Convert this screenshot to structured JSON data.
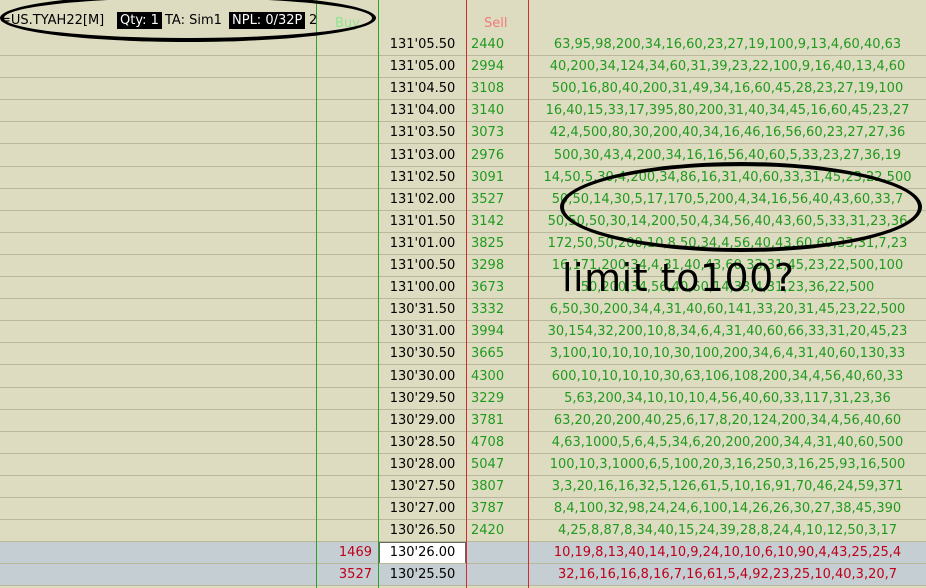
{
  "header": {
    "symbol": "=US.TYAH22[M]",
    "qty": "Qty: 1",
    "ta": "TA: Sim1",
    "npl": "NPL: 0/32P",
    "extra": "2",
    "buy_label": "Buy",
    "sell_label": "Sell"
  },
  "colors": {
    "background": "#dedcc0",
    "green_text": "#1f9a1f",
    "red_text": "#c0001a",
    "bid_row_bg": "#c4ced3",
    "grid_line": "#b9b79c"
  },
  "rows": [
    {
      "price": "131'05.50",
      "buy": "",
      "sell": "2440",
      "depth": "63,95,98,200,34,16,60,23,27,19,100,9,13,4,60,40,63",
      "low": false
    },
    {
      "price": "131'05.00",
      "buy": "",
      "sell": "2994",
      "depth": "40,200,34,124,34,60,31,39,23,22,100,9,16,40,13,4,60",
      "low": false
    },
    {
      "price": "131'04.50",
      "buy": "",
      "sell": "3108",
      "depth": "500,16,80,40,200,31,49,34,16,60,45,28,23,27,19,100",
      "low": false
    },
    {
      "price": "131'04.00",
      "buy": "",
      "sell": "3140",
      "depth": "16,40,15,33,17,395,80,200,31,40,34,45,16,60,45,23,27",
      "low": false
    },
    {
      "price": "131'03.50",
      "buy": "",
      "sell": "3073",
      "depth": "42,4,500,80,30,200,40,34,16,46,16,56,60,23,27,27,36",
      "low": false
    },
    {
      "price": "131'03.00",
      "buy": "",
      "sell": "2976",
      "depth": "500,30,43,4,200,34,16,16,56,40,60,5,33,23,27,36,19",
      "low": false
    },
    {
      "price": "131'02.50",
      "buy": "",
      "sell": "3091",
      "depth": "14,50,5,30,4,200,34,86,16,31,40,60,33,31,45,23,22,500",
      "low": false
    },
    {
      "price": "131'02.00",
      "buy": "",
      "sell": "3527",
      "depth": "50,50,14,30,5,17,170,5,200,4,34,16,56,40,43,60,33,7",
      "low": false
    },
    {
      "price": "131'01.50",
      "buy": "",
      "sell": "3142",
      "depth": "50,50,50,30,14,200,50,4,34,56,40,43,60,5,33,31,23,36",
      "low": false
    },
    {
      "price": "131'01.00",
      "buy": "",
      "sell": "3825",
      "depth": "172,50,50,200,10,8,50,34,4,56,40,43,60,60,33,31,7,23",
      "low": false
    },
    {
      "price": "131'00.50",
      "buy": "",
      "sell": "3298",
      "depth": "16,171,200,34,4,31,40,43,60,33,31,45,23,22,500,100",
      "low": false
    },
    {
      "price": "131'00.00",
      "buy": "",
      "sell": "3673",
      "depth": "50,200,34,56,40,60,14,33,4,31,23,36,22,500",
      "low": false
    },
    {
      "price": "130'31.50",
      "buy": "",
      "sell": "3332",
      "depth": "6,50,30,200,34,4,31,40,60,141,33,20,31,45,23,22,500",
      "low": false
    },
    {
      "price": "130'31.00",
      "buy": "",
      "sell": "3994",
      "depth": "30,154,32,200,10,8,34,6,4,31,40,60,66,33,31,20,45,23",
      "low": false
    },
    {
      "price": "130'30.50",
      "buy": "",
      "sell": "3665",
      "depth": "3,100,10,10,10,10,30,100,200,34,6,4,31,40,60,130,33",
      "low": false
    },
    {
      "price": "130'30.00",
      "buy": "",
      "sell": "4300",
      "depth": "600,10,10,10,10,30,63,106,108,200,34,4,56,40,60,33",
      "low": false
    },
    {
      "price": "130'29.50",
      "buy": "",
      "sell": "3229",
      "depth": "5,63,200,34,10,10,10,4,56,40,60,33,117,31,23,36",
      "low": false
    },
    {
      "price": "130'29.00",
      "buy": "",
      "sell": "3781",
      "depth": "63,20,20,200,40,25,6,17,8,20,124,200,34,4,56,40,60",
      "low": false
    },
    {
      "price": "130'28.50",
      "buy": "",
      "sell": "4708",
      "depth": "4,63,1000,5,6,4,5,34,6,20,200,200,34,4,31,40,60,500",
      "low": false
    },
    {
      "price": "130'28.00",
      "buy": "",
      "sell": "5047",
      "depth": "100,10,3,1000,6,5,100,20,3,16,250,3,16,25,93,16,500",
      "low": false
    },
    {
      "price": "130'27.50",
      "buy": "",
      "sell": "3807",
      "depth": "3,3,20,16,16,32,5,126,61,5,10,16,91,70,46,24,59,371",
      "low": false
    },
    {
      "price": "130'27.00",
      "buy": "",
      "sell": "3787",
      "depth": "8,4,100,32,98,24,24,6,100,14,26,26,30,27,38,45,390",
      "low": false
    },
    {
      "price": "130'26.50",
      "buy": "",
      "sell": "2420",
      "depth": "4,25,8,87,8,34,40,15,24,39,28,8,24,4,10,12,50,3,17",
      "low": false
    },
    {
      "price": "130'26.00",
      "buy": "1469",
      "sell": "",
      "depth": "10,19,8,13,40,14,10,9,24,10,10,6,10,90,4,43,25,25,4",
      "low": true,
      "current": true
    },
    {
      "price": "130'25.50",
      "buy": "3527",
      "sell": "",
      "depth": "32,16,16,16,8,16,7,16,61,5,4,92,23,25,10,40,3,20,7",
      "low": true
    }
  ],
  "annotation": {
    "text": "limit to100?"
  }
}
